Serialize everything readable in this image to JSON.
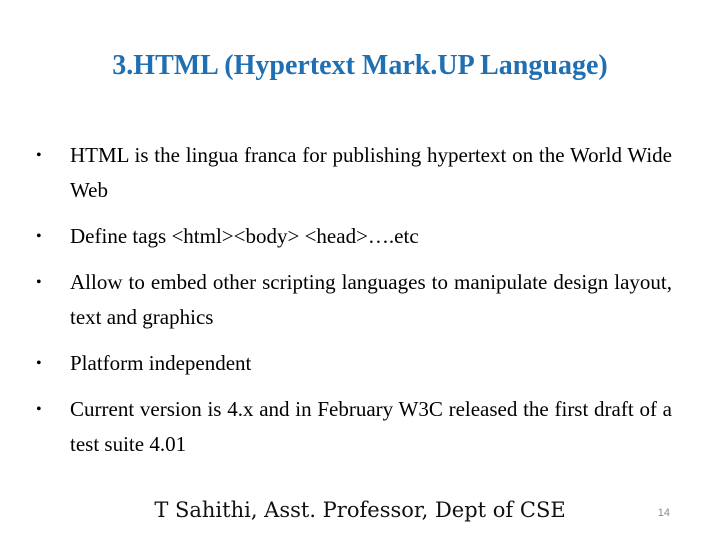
{
  "slide": {
    "title": "3.HTML (Hypertext Mark.UP Language)",
    "title_color": "#1f6fb2",
    "bullets": [
      {
        "icon": "bullet-dot",
        "text": "HTML is the lingua franca for publishing hypertext on the World Wide Web"
      },
      {
        "icon": "bullet-dot",
        "text": "Define tags <html><body> <head>….etc"
      },
      {
        "icon": "bullet-dot",
        "text": "Allow to embed other scripting languages to manipulate design layout, text and graphics"
      },
      {
        "icon": "bullet-dot",
        "text": "Platform independent"
      },
      {
        "icon": "bullet-dot",
        "text": "Current version is 4.x and in February W3C released the first draft of a test suite 4.01"
      }
    ],
    "footer": "T Sahithi, Asst. Professor, Dept of CSE",
    "page_number": "14",
    "bullet_glyph": "•"
  }
}
